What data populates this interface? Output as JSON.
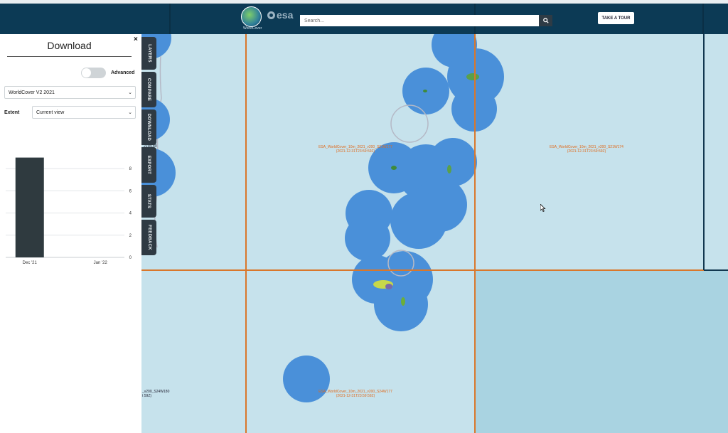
{
  "header": {
    "logo_label": "WorldCover",
    "esa_label": "esa",
    "search": {
      "placeholder": "Search..."
    },
    "tour_label": "TAKE A TOUR"
  },
  "panel": {
    "title": "Download",
    "close": "×",
    "advanced_label": "Advanced",
    "advanced_on": false,
    "product_select": "WorldCover V2 2021",
    "extent_label": "Extent",
    "extent_select": "Current view"
  },
  "side_tabs": [
    "LAYERS",
    "COMPARE",
    "DOWNLOAD",
    "EXPORT",
    "STATS",
    "FEEDBACK"
  ],
  "chart_data": {
    "type": "bar",
    "categories": [
      "Dec '21",
      "Jan '22"
    ],
    "values": [
      9,
      0
    ],
    "yticks": [
      0,
      2,
      4,
      6,
      8
    ],
    "ylim": [
      0,
      10
    ],
    "bar_color": "#2f3a3f"
  },
  "map": {
    "tile_labels": [
      {
        "line1": "ESA_WorldCover_10m_2021_v200_S21W177",
        "line2": "(2021-12-31T23:59:59Z)"
      },
      {
        "line1": "ESA_WorldCover_10m_2021_v200_S21W174",
        "line2": "(2021-12-31T23:59:59Z)"
      },
      {
        "line1": "ESA_WorldCover_10m_2021_v200_S24W177",
        "line2": "(2021-12-31T23:59:59Z)"
      }
    ],
    "edge_labels": [
      {
        "line1": "21W180"
      },
      {
        "line1": "_v200_S24W180",
        "line2": "t 59Z)"
      }
    ],
    "colors": {
      "water": "#c6e2ec",
      "water_dark": "#a9d3e1",
      "blob": "#4a90d9",
      "grid": "#d9772b",
      "border": "#12374f"
    }
  }
}
